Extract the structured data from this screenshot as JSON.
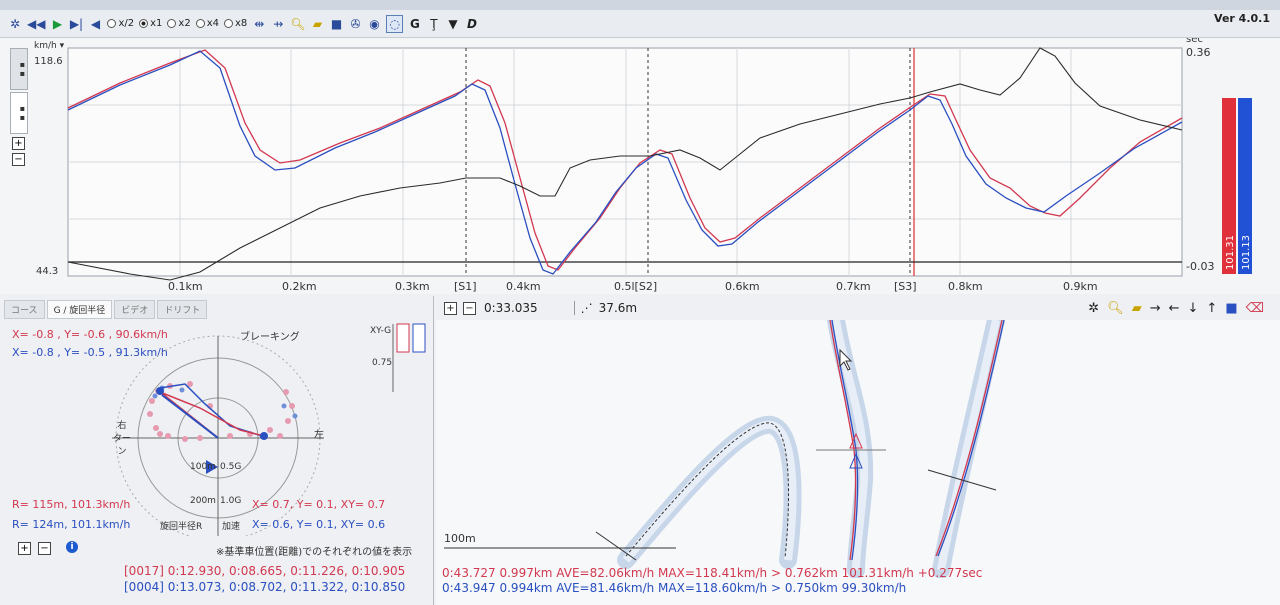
{
  "version": "Ver 4.0.1",
  "toolbar": {
    "speeds": [
      "x/2",
      "x1",
      "x2",
      "x4",
      "x8"
    ],
    "selected_speed": "x1"
  },
  "top_chart": {
    "left_unit": "km/h",
    "y_max": "118.6",
    "y_min": "44.3",
    "right_unit": "sec",
    "right_max": "0.36",
    "right_min": "-0.03",
    "x_ticks": [
      "0.1km",
      "0.2km",
      "0.3km",
      "[S1]",
      "0.4km",
      "0.5l[S2]",
      "0.6km",
      "0.7km",
      "[S3]",
      "0.8km",
      "0.9km"
    ],
    "legend_red": "101.31",
    "legend_blue": "101.13",
    "colors": {
      "red": "#d2384f",
      "blue": "#2a4fc0",
      "delta": "#222222"
    }
  },
  "g_panel": {
    "tabs": [
      "コース",
      "G / 旋回半径",
      "ビデオ",
      "ドリフト"
    ],
    "active_tab": "G / 旋回半径",
    "red_xy": "X= -0.8 , Y= -0.6 ,  90.6km/h",
    "blue_xy": "X= -0.8 , Y= -0.5 ,  91.3km/h",
    "braking_label": "ブレーキング",
    "scale_label": "XY-G",
    "scale_value": "0.75",
    "right_label": "右\nターン",
    "left_label": "左",
    "radius_100": "100m",
    "g_05": "0.5G",
    "radius_200": "200m",
    "g_10": "1.0G",
    "red_radius": "R= 115m, 101.3km/h",
    "blue_radius": "R= 124m, 101.1km/h",
    "turn_radius_label": "旋回半径R",
    "accel_label": "加速",
    "red_g": "X=  0.7,  Y=  0.1,  XY= 0.7",
    "blue_g": "X=  0.6,  Y=  0.1,  XY= 0.6",
    "footnote": "※基準車位置(距離)でのそれぞれの値を表示",
    "red_lap": "[0017]  0:12.930,  0:08.665,  0:11.226,  0:10.905",
    "blue_lap": "[0004]  0:13.073,  0:08.702,  0:11.322,  0:10.850"
  },
  "map_panel": {
    "time": "0:33.035",
    "distance": "37.6m",
    "scale": "100m",
    "red_status": "0:43.727  0.997km  AVE=82.06km/h  MAX=118.41km/h  >  0.762km  101.31km/h  +0.277sec",
    "blue_status": "0:43.947  0.994km  AVE=81.46km/h  MAX=118.60km/h  >  0.750km  99.30km/h"
  }
}
